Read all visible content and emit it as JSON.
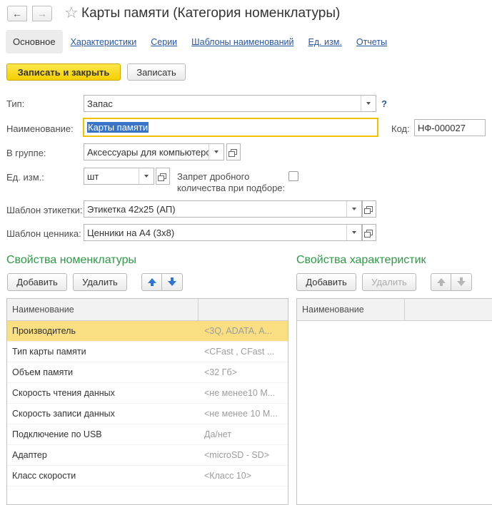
{
  "window": {
    "title": "Карты памяти (Категория номенклатуры)",
    "back_icon": "←",
    "forward_icon": "→",
    "favorite_icon": "☆"
  },
  "tabs": [
    {
      "label": "Основное",
      "active": true
    },
    {
      "label": "Характеристики"
    },
    {
      "label": "Серии"
    },
    {
      "label": "Шаблоны наименований"
    },
    {
      "label": "Ед. изм."
    },
    {
      "label": "Отчеты"
    }
  ],
  "toolbar": {
    "save_close_label": "Записать и закрыть",
    "save_label": "Записать"
  },
  "form": {
    "type_label": "Тип:",
    "type_value": "Запас",
    "help": "?",
    "name_label": "Наименование:",
    "name_value": "Карты памяти",
    "code_label": "Код:",
    "code_value": "НФ-000027",
    "group_label": "В группе:",
    "group_value": "Аксессуары для компьютеров",
    "unit_label": "Ед. изм.:",
    "unit_value": "шт",
    "fraction_label_1": "Запрет дробного",
    "fraction_label_2": "количества при подборе:",
    "fraction_checked": false,
    "label_template_label": "Шаблон этикетки:",
    "label_template_value": "Этикетка 42x25 (АП)",
    "price_template_label": "Шаблон ценника:",
    "price_template_value": "Ценники на А4 (3х8)"
  },
  "left_section": {
    "title": "Свойства номенклатуры",
    "add_label": "Добавить",
    "delete_label": "Удалить",
    "column_header": "Наименование",
    "rows": [
      {
        "name": "Производитель",
        "value": "<3Q, ADATA, A...",
        "selected": true
      },
      {
        "name": "Тип карты памяти",
        "value": "<CFast , CFast ..."
      },
      {
        "name": "Объем памяти",
        "value": "<32 Гб>"
      },
      {
        "name": "Скорость чтения данных",
        "value": "<не менее10 М..."
      },
      {
        "name": "Скорость записи данных",
        "value": "<не менее 10 М..."
      },
      {
        "name": "Подключение по USB",
        "value": "Да/нет"
      },
      {
        "name": "Адаптер",
        "value": "<microSD - SD>"
      },
      {
        "name": "Класс скорости",
        "value": "<Класс 10>"
      }
    ]
  },
  "right_section": {
    "title": "Свойства характеристик",
    "add_label": "Добавить",
    "delete_label": "Удалить",
    "column_header": "Наименование"
  },
  "colors": {
    "accent_green": "#2e9a46",
    "link_blue": "#2a55a0",
    "primary_yellow": "#f4cf00",
    "selection_row": "#f9df82"
  }
}
